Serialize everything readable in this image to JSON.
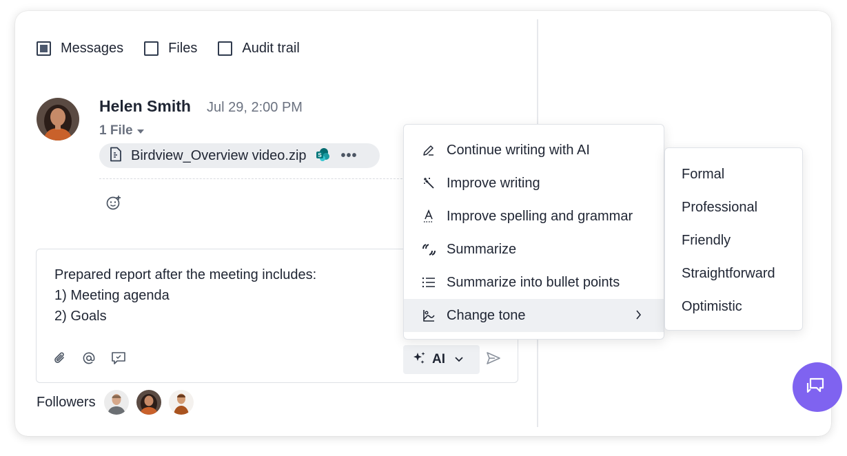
{
  "filters": [
    {
      "label": "Messages",
      "checked": true
    },
    {
      "label": "Files",
      "checked": false
    },
    {
      "label": "Audit trail",
      "checked": false
    }
  ],
  "message": {
    "author": "Helen Smith",
    "timestamp": "Jul 29, 2:00 PM",
    "file_count": "1 File",
    "file_name": "Birdview_Overview video.zip",
    "file_icon": "zip-file-icon",
    "more_icon": "more-dots-icon",
    "react_icon": "add-emoji-icon"
  },
  "composer": {
    "lines": [
      "Prepared report after the meeting includes:",
      "1) Meeting agenda",
      "2) Goals"
    ],
    "tools": [
      "paperclip-icon",
      "mention-icon",
      "comment-icon"
    ],
    "ai_label": "AI",
    "send_icon": "send-icon"
  },
  "followers": {
    "label": "Followers",
    "count": 3
  },
  "ai_menu": {
    "items": [
      {
        "label": "Continue writing with AI",
        "icon": "pen-icon"
      },
      {
        "label": "Improve writing",
        "icon": "magic-wand-icon"
      },
      {
        "label": "Improve spelling and grammar",
        "icon": "spellcheck-icon"
      },
      {
        "label": "Summarize",
        "icon": "quote-icon"
      },
      {
        "label": "Summarize into bullet points",
        "icon": "list-icon"
      },
      {
        "label": "Change tone",
        "icon": "tone-icon",
        "active": true,
        "has_submenu": true
      }
    ]
  },
  "tone_menu": {
    "items": [
      "Formal",
      "Professional",
      "Friendly",
      "Straightforward",
      "Optimistic"
    ]
  },
  "colors": {
    "accent": "#7f63f0",
    "text": "#1f2533",
    "muted": "#6b7280",
    "hover_bg": "#eef0f3"
  }
}
